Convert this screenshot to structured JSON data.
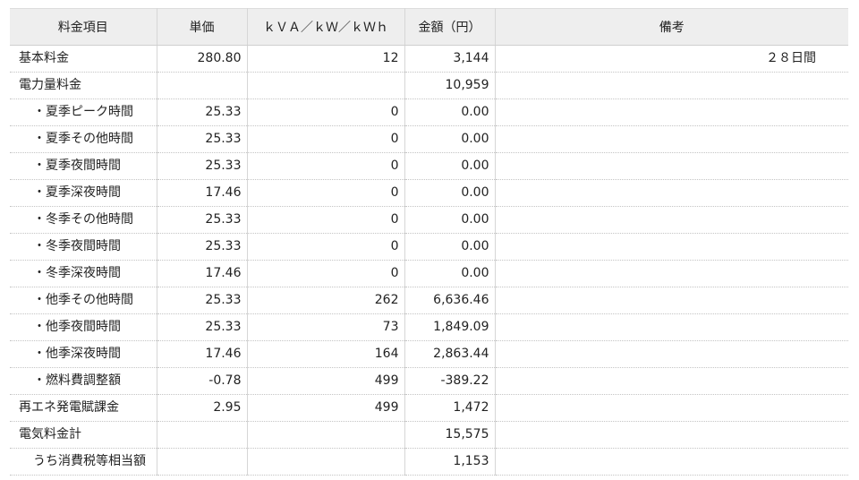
{
  "headers": [
    "料金項目",
    "単価",
    "ｋＶＡ／ｋＷ／ｋＷｈ",
    "金額（円）",
    "備考"
  ],
  "rows": [
    {
      "item": "基本料金",
      "price": "280.80",
      "qty": "12",
      "amount": "3,144",
      "note": "２８日間",
      "style": "top"
    },
    {
      "item": "電力量料金",
      "price": "",
      "qty": "",
      "amount": "10,959",
      "note": "",
      "style": "top"
    },
    {
      "item": "・夏季ピーク時間",
      "price": "25.33",
      "qty": "0",
      "amount": "0.00",
      "note": "",
      "style": "sub"
    },
    {
      "item": "・夏季その他時間",
      "price": "25.33",
      "qty": "0",
      "amount": "0.00",
      "note": "",
      "style": "sub"
    },
    {
      "item": "・夏季夜間時間",
      "price": "25.33",
      "qty": "0",
      "amount": "0.00",
      "note": "",
      "style": "sub"
    },
    {
      "item": "・夏季深夜時間",
      "price": "17.46",
      "qty": "0",
      "amount": "0.00",
      "note": "",
      "style": "sub"
    },
    {
      "item": "・冬季その他時間",
      "price": "25.33",
      "qty": "0",
      "amount": "0.00",
      "note": "",
      "style": "sub"
    },
    {
      "item": "・冬季夜間時間",
      "price": "25.33",
      "qty": "0",
      "amount": "0.00",
      "note": "",
      "style": "sub"
    },
    {
      "item": "・冬季深夜時間",
      "price": "17.46",
      "qty": "0",
      "amount": "0.00",
      "note": "",
      "style": "sub"
    },
    {
      "item": "・他季その他時間",
      "price": "25.33",
      "qty": "262",
      "amount": "6,636.46",
      "note": "",
      "style": "sub"
    },
    {
      "item": "・他季夜間時間",
      "price": "25.33",
      "qty": "73",
      "amount": "1,849.09",
      "note": "",
      "style": "sub"
    },
    {
      "item": "・他季深夜時間",
      "price": "17.46",
      "qty": "164",
      "amount": "2,863.44",
      "note": "",
      "style": "sub"
    },
    {
      "item": "・燃料費調整額",
      "price": "-0.78",
      "qty": "499",
      "amount": "-389.22",
      "note": "",
      "style": "sub"
    },
    {
      "item": "再エネ発電賦課金",
      "price": "2.95",
      "qty": "499",
      "amount": "1,472",
      "note": "",
      "style": "top"
    },
    {
      "item": "電気料金計",
      "price": "",
      "qty": "",
      "amount": "15,575",
      "note": "",
      "style": "top"
    },
    {
      "item": "うち消費税等相当額",
      "price": "",
      "qty": "",
      "amount": "1,153",
      "note": "",
      "style": "indent"
    }
  ]
}
